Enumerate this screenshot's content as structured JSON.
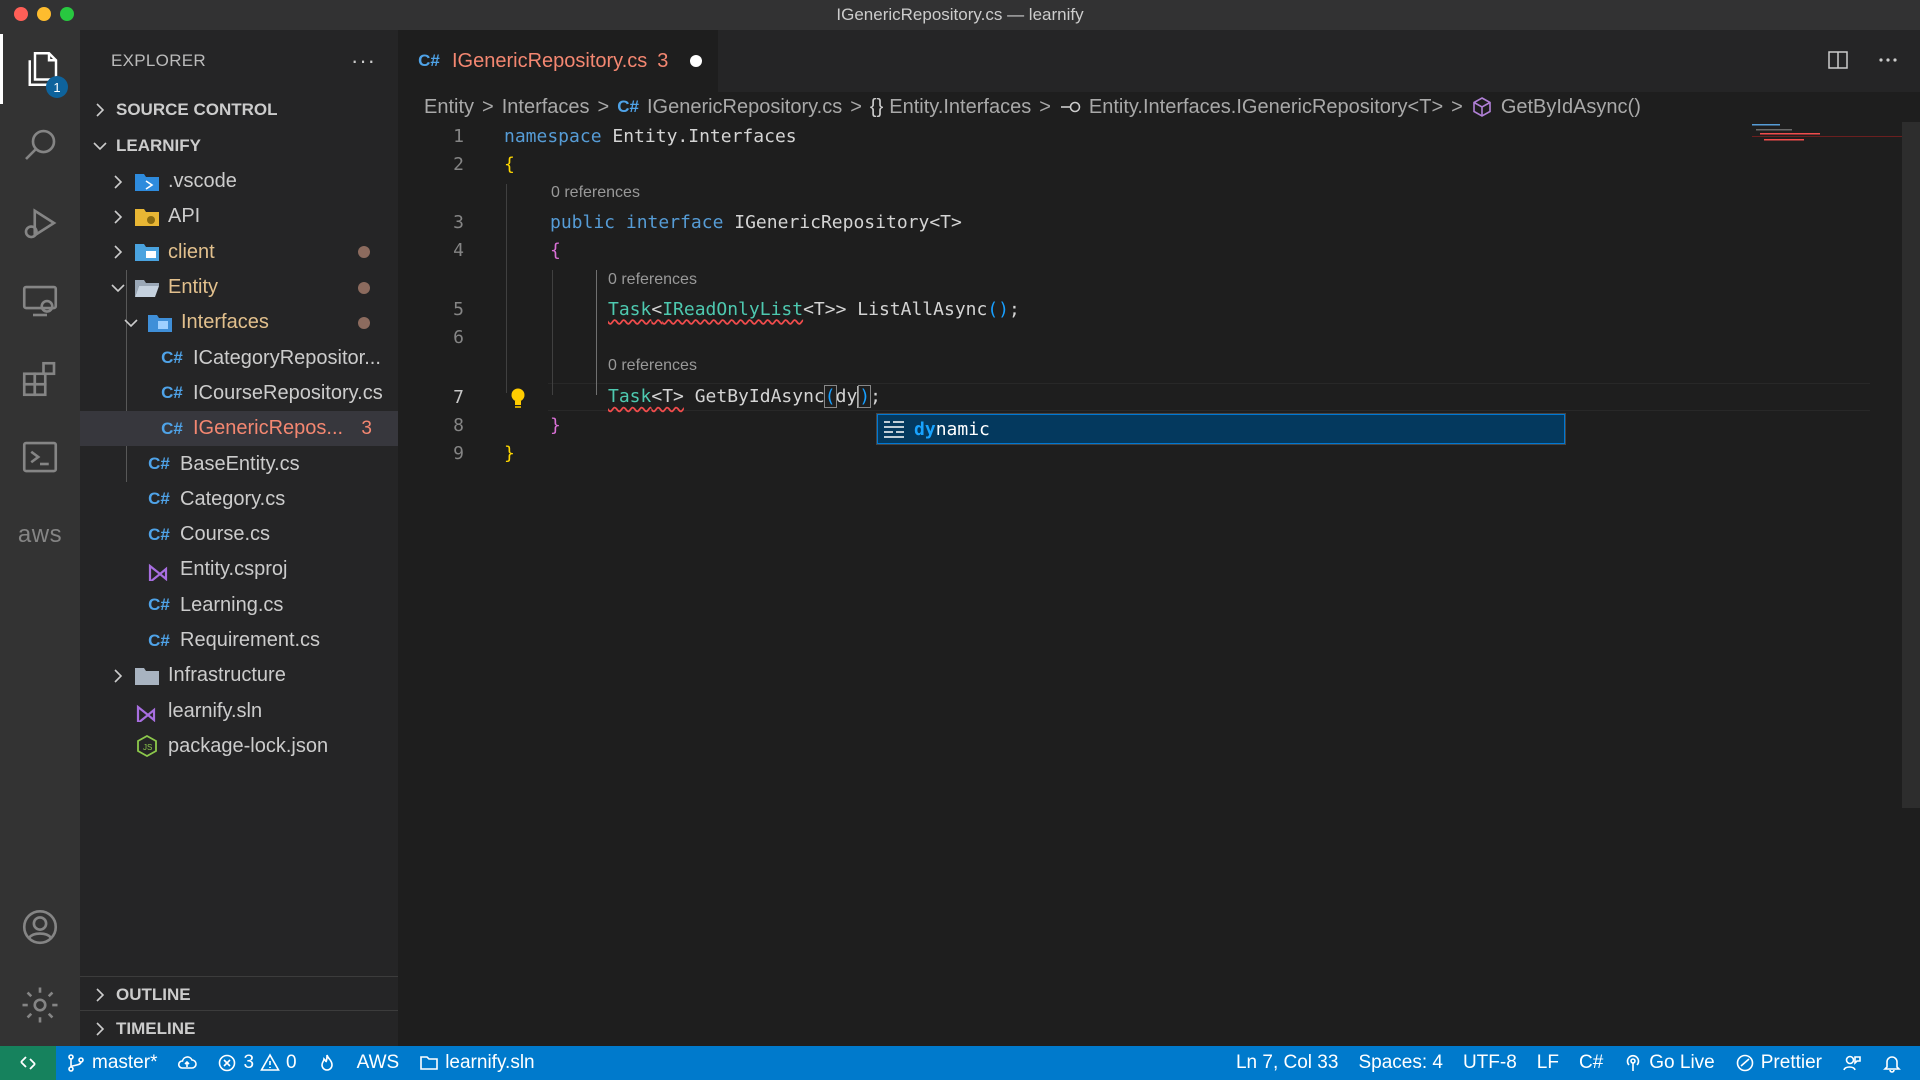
{
  "window": {
    "title": "IGenericRepository.cs — learnify"
  },
  "activity_bar": {
    "explorer_badge": "1",
    "aws_label": "aws"
  },
  "sidebar": {
    "title": "EXPLORER",
    "more": "···",
    "source_control": "SOURCE CONTROL",
    "workspace": "LEARNIFY",
    "items": [
      {
        "label": ".vscode"
      },
      {
        "label": "API"
      },
      {
        "label": "client"
      },
      {
        "label": "Entity"
      },
      {
        "label": "Interfaces"
      },
      {
        "label": "ICategoryRepositor..."
      },
      {
        "label": "ICourseRepository.cs"
      },
      {
        "label": "IGenericRepos...",
        "problems": "3"
      },
      {
        "label": "BaseEntity.cs"
      },
      {
        "label": "Category.cs"
      },
      {
        "label": "Course.cs"
      },
      {
        "label": "Entity.csproj"
      },
      {
        "label": "Learning.cs"
      },
      {
        "label": "Requirement.cs"
      },
      {
        "label": "Infrastructure"
      },
      {
        "label": "learnify.sln"
      },
      {
        "label": "package-lock.json"
      }
    ],
    "outline": "OUTLINE",
    "timeline": "TIMELINE",
    "cs_glyph": "C#"
  },
  "tab": {
    "lang": "C#",
    "name": "IGenericRepository.cs",
    "problems": "3"
  },
  "breadcrumb": {
    "items": [
      "Entity",
      "Interfaces",
      "IGenericRepository.cs",
      "Entity.Interfaces",
      "Entity.Interfaces.IGenericRepository<T>",
      "GetByIdAsync()"
    ],
    "sep": ">",
    "cs": "C#",
    "ns_sym": "{}"
  },
  "editor": {
    "line_numbers": [
      "1",
      "2",
      "3",
      "4",
      "5",
      "6",
      "7",
      "8",
      "9"
    ],
    "code_lens": "0 references",
    "l1_kw": "namespace",
    "l1_rest": " Entity.Interfaces",
    "l2": "{",
    "l3_kw1": "public",
    "l3_kw2": "interface",
    "l3_rest": " IGenericRepository<T>",
    "l4": "{",
    "l5_task": "Task",
    "l5_lt": "<",
    "l5_list": "IReadOnlyList",
    "l5_inner": "<T>",
    "l5_gt": ">",
    "l5_rest": " ListAllAsync",
    "l5_parens": "()",
    "l5_semi": ";",
    "l7_task": "Task",
    "l7_tparam": "<T>",
    "l7_rest": " GetByIdAsync",
    "l7_open": "(",
    "l7_typed": "dy",
    "l7_close": ")",
    "l7_semi": ";",
    "l8": "}",
    "l9": "}"
  },
  "suggest": {
    "match": "dy",
    "rest": "namic"
  },
  "status": {
    "branch": "master*",
    "errors": "3",
    "warnings": "0",
    "aws": "AWS",
    "solution": "learnify.sln",
    "position": "Ln 7, Col 33",
    "spaces": "Spaces: 4",
    "encoding": "UTF-8",
    "eol": "LF",
    "language": "C#",
    "golive": "Go Live",
    "prettier": "Prettier"
  },
  "colors": {
    "accent": "#007acc",
    "error": "#f48771",
    "modified": "#e2c08d",
    "keyword": "#569cd6",
    "type": "#4ec9b0"
  }
}
